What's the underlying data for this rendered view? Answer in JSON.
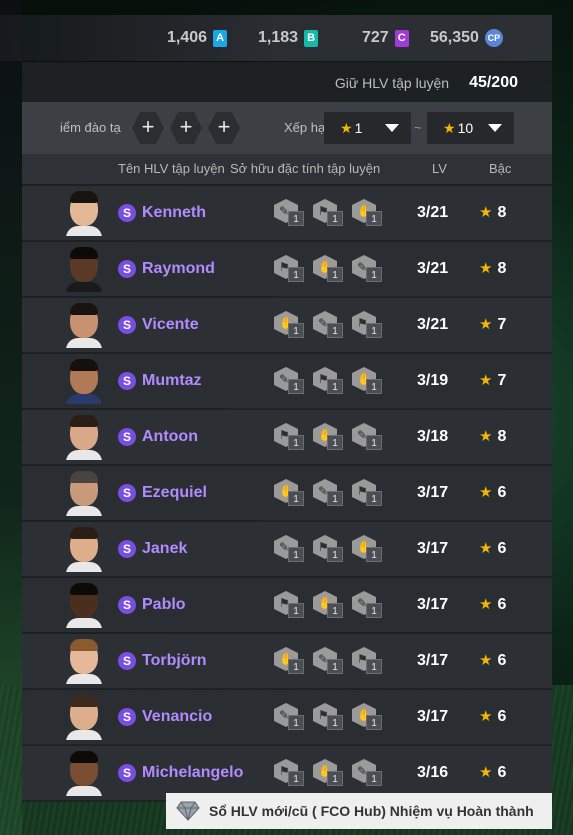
{
  "currencies": [
    {
      "value": "1,406",
      "icon_label": "A",
      "icon": "currency-a-icon"
    },
    {
      "value": "1,183",
      "icon_label": "B",
      "icon": "currency-b-icon"
    },
    {
      "value": "727",
      "icon_label": "C",
      "icon": "currency-c-icon"
    },
    {
      "value": "56,350",
      "icon_label": "CP",
      "icon": "currency-cp-icon"
    }
  ],
  "quota": {
    "label": "Giữ HLV tập luyện",
    "value": "45/200"
  },
  "filter": {
    "training_points_label": "iểm đào tạ",
    "rank_label": "Xếp hạ",
    "rank_min": "1",
    "rank_max": "10",
    "separator": "~"
  },
  "columns": {
    "name": "Tên HLV tập luyện",
    "traits": "Sở hữu đặc tính tập luyện",
    "lv": "LV",
    "grade": "Bậc"
  },
  "coaches": [
    {
      "badge": "S",
      "name": "Kenneth",
      "lv": "3/21",
      "grade": "8",
      "traits": [
        "1",
        "1",
        "1"
      ],
      "skin": "#e2b896",
      "hair": "#1a1410",
      "shirt": "#e8e8e8"
    },
    {
      "badge": "S",
      "name": "Raymond",
      "lv": "3/21",
      "grade": "8",
      "traits": [
        "1",
        "1",
        "1"
      ],
      "skin": "#5a3a26",
      "hair": "#0e0a08",
      "shirt": "#1a1a1a"
    },
    {
      "badge": "S",
      "name": "Vicente",
      "lv": "3/21",
      "grade": "7",
      "traits": [
        "1",
        "1",
        "1"
      ],
      "skin": "#c89270",
      "hair": "#1a1410",
      "shirt": "#e8e8e8"
    },
    {
      "badge": "S",
      "name": "Mumtaz",
      "lv": "3/19",
      "grade": "7",
      "traits": [
        "1",
        "1",
        "1"
      ],
      "skin": "#b07a58",
      "hair": "#15100c",
      "shirt": "#2a3a6a"
    },
    {
      "badge": "S",
      "name": "Antoon",
      "lv": "3/18",
      "grade": "8",
      "traits": [
        "1",
        "1",
        "1"
      ],
      "skin": "#d8a888",
      "hair": "#2a1e16",
      "shirt": "#e8e8e8"
    },
    {
      "badge": "S",
      "name": "Ezequiel",
      "lv": "3/17",
      "grade": "6",
      "traits": [
        "1",
        "1",
        "1"
      ],
      "skin": "#c89a7a",
      "hair": "#4a4440",
      "shirt": "#e8e8e8"
    },
    {
      "badge": "S",
      "name": "Janek",
      "lv": "3/17",
      "grade": "6",
      "traits": [
        "1",
        "1",
        "1"
      ],
      "skin": "#dcae8c",
      "hair": "#2a1e16",
      "shirt": "#e8e8e8"
    },
    {
      "badge": "S",
      "name": "Pablo",
      "lv": "3/17",
      "grade": "6",
      "traits": [
        "1",
        "1",
        "1"
      ],
      "skin": "#4a2e1e",
      "hair": "#0e0a08",
      "shirt": "#e8e8e8"
    },
    {
      "badge": "S",
      "name": "Torbjörn",
      "lv": "3/17",
      "grade": "6",
      "traits": [
        "1",
        "1",
        "1"
      ],
      "skin": "#e4b898",
      "hair": "#8a5a30",
      "shirt": "#e8e8e8"
    },
    {
      "badge": "S",
      "name": "Venancio",
      "lv": "3/17",
      "grade": "6",
      "traits": [
        "1",
        "1",
        "1"
      ],
      "skin": "#dcae8c",
      "hair": "#3a2a1e",
      "shirt": "#e8e8e8"
    },
    {
      "badge": "S",
      "name": "Michelangelo",
      "lv": "3/16",
      "grade": "6",
      "traits": [
        "1",
        "1",
        "1"
      ],
      "skin": "#7a4e32",
      "hair": "#0e0a08",
      "shirt": "#e8e8e8"
    }
  ],
  "footer": {
    "label": "Sổ HLV mới/cũ ( FCO Hub) Nhiệm vụ Hoàn thành",
    "icon": "diamond-icon"
  },
  "colors": {
    "accent_name": "#b28bff",
    "star": "#f0b800",
    "badge": "#7a4ee0"
  }
}
